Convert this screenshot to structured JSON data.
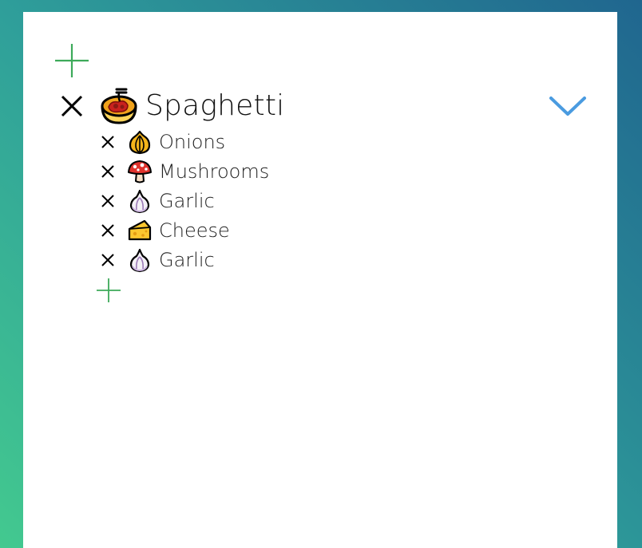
{
  "colors": {
    "accent_green": "#3daa5a",
    "accent_blue": "#4a9be0",
    "text": "#111111"
  },
  "toolbar": {
    "add_recipe_icon": "plus-icon"
  },
  "recipe": {
    "name": "Spaghetti",
    "icon": "spaghetti-icon",
    "remove_icon": "close-icon",
    "expand_icon": "chevron-down-icon"
  },
  "ingredients": [
    {
      "name": "Onions",
      "icon": "onion-icon"
    },
    {
      "name": "Mushrooms",
      "icon": "mushroom-icon"
    },
    {
      "name": "Garlic",
      "icon": "garlic-icon"
    },
    {
      "name": "Cheese",
      "icon": "cheese-icon"
    },
    {
      "name": "Garlic",
      "icon": "garlic-icon"
    }
  ],
  "add_ingredient_icon": "plus-icon"
}
